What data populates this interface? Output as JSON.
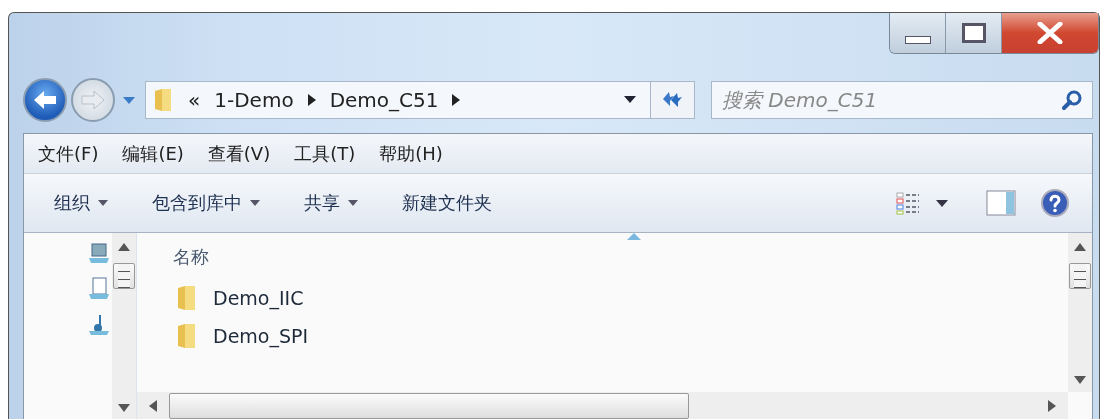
{
  "address": {
    "overflow": "«",
    "crumbs": [
      "1-Demo",
      "Demo_C51"
    ]
  },
  "search": {
    "placeholder": "搜索 Demo_C51"
  },
  "menu": [
    "文件(F)",
    "编辑(E)",
    "查看(V)",
    "工具(T)",
    "帮助(H)"
  ],
  "toolbar": [
    {
      "label": "组织",
      "dropdown": true
    },
    {
      "label": "包含到库中",
      "dropdown": true
    },
    {
      "label": "共享",
      "dropdown": true
    },
    {
      "label": "新建文件夹",
      "dropdown": false
    }
  ],
  "columns": [
    {
      "label": "名称",
      "sorted": true
    }
  ],
  "files": [
    {
      "name": "Demo_IIC"
    },
    {
      "name": "Demo_SPI"
    }
  ]
}
